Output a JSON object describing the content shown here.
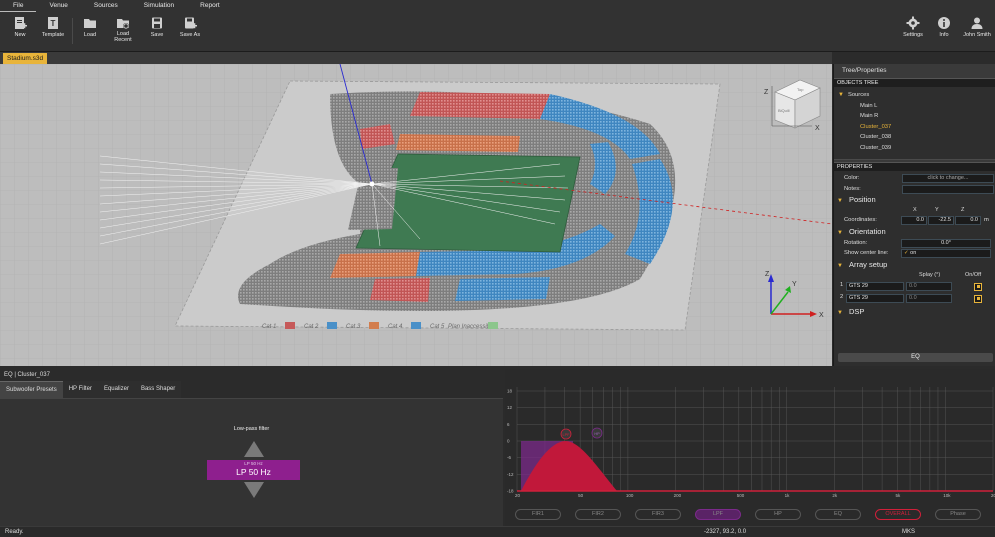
{
  "menu": {
    "tabs": [
      "File",
      "Venue",
      "Sources",
      "Simulation",
      "Report"
    ]
  },
  "toolbar": {
    "new_label": "New",
    "template_label": "Template",
    "load_label": "Load",
    "load_recent_label": "Load\nRecent",
    "save_label": "Save",
    "save_as_label": "Save As",
    "settings_label": "Settings",
    "info_label": "Info",
    "user_label": "John Smith"
  },
  "document_tab": "Stadium.s3d",
  "viewport": {
    "view_cube_labels": {
      "top": "Top",
      "front": "BiQuill"
    },
    "axes": {
      "x": "X",
      "y": "Y",
      "z": "Z"
    },
    "legend": [
      "Cat 1",
      "Cat 2",
      "Cat 3",
      "Cat 4",
      "Cat 5",
      "Plan Inaccessible"
    ],
    "colors": {
      "cat_red": "#c65a5a",
      "cat_blue": "#4a90c8",
      "cat_orange": "#d27d4d",
      "pitch": "#3f7a52",
      "seat_gray": "#8a8a8a"
    }
  },
  "right_panel": {
    "title": "Tree/Properties",
    "objects_tree_header": "OBJECTS TREE",
    "tree": {
      "root": "Sources",
      "items": [
        "Main L",
        "Main R",
        "Cluster_037",
        "Cluster_038",
        "Cluster_039"
      ],
      "selected": "Cluster_037"
    },
    "properties_header": "PROPERTIES",
    "color_label": "Color:",
    "color_value": "click to change...",
    "notes_label": "Notes:",
    "position_section": "Position",
    "coord_headers": [
      "X",
      "Y",
      "Z"
    ],
    "coordinates_label": "Coordinates:",
    "coordinates": [
      "0.0",
      "-22.5",
      "0.0"
    ],
    "coord_unit": "m",
    "orientation_section": "Orientation",
    "rotation_label": "Rotation:",
    "rotation_value": "0.0°",
    "center_line_label": "Show center line:",
    "center_line_value": "on",
    "array_section": "Array setup",
    "splay_header": "Splay (°)",
    "onoff_header": "On/Off",
    "array_rows": [
      {
        "index": "1",
        "model": "GTS 29",
        "splay": "0.0"
      },
      {
        "index": "2",
        "model": "GTS 29",
        "splay": "0.0"
      }
    ],
    "dsp_section": "DSP",
    "eq_button": "EQ"
  },
  "eq": {
    "title": "EQ | Cluster_037",
    "tabs": [
      "Subwoofer Presets",
      "HP Filter",
      "Equalizer",
      "Bass Shaper"
    ],
    "active_tab": "Subwoofer Presets",
    "lowpass_title": "Low-pass filter",
    "lowpass_small": "LP 50 Hz",
    "lowpass_value": "LP 50 Hz"
  },
  "graph": {
    "y_ticks": [
      "18",
      "12",
      "6",
      "0",
      "-6",
      "-12",
      "-18"
    ],
    "x_ticks": [
      "20",
      "50",
      "100",
      "200",
      "500",
      "1k",
      "2k",
      "5k",
      "10k",
      "20k"
    ],
    "markers": [
      "LPF",
      "HP"
    ],
    "buttons": [
      "FIR1",
      "FIR2",
      "FIR3",
      "LPF",
      "HP",
      "EQ",
      "OVERALL",
      "Phase"
    ],
    "colors": {
      "curve": "#d0203a",
      "fill": "#c1183a",
      "purple": "#7b2a8a"
    }
  },
  "status": {
    "message": "Ready.",
    "cursor": "-2327, 93.2, 0.0",
    "units": "MKS"
  }
}
